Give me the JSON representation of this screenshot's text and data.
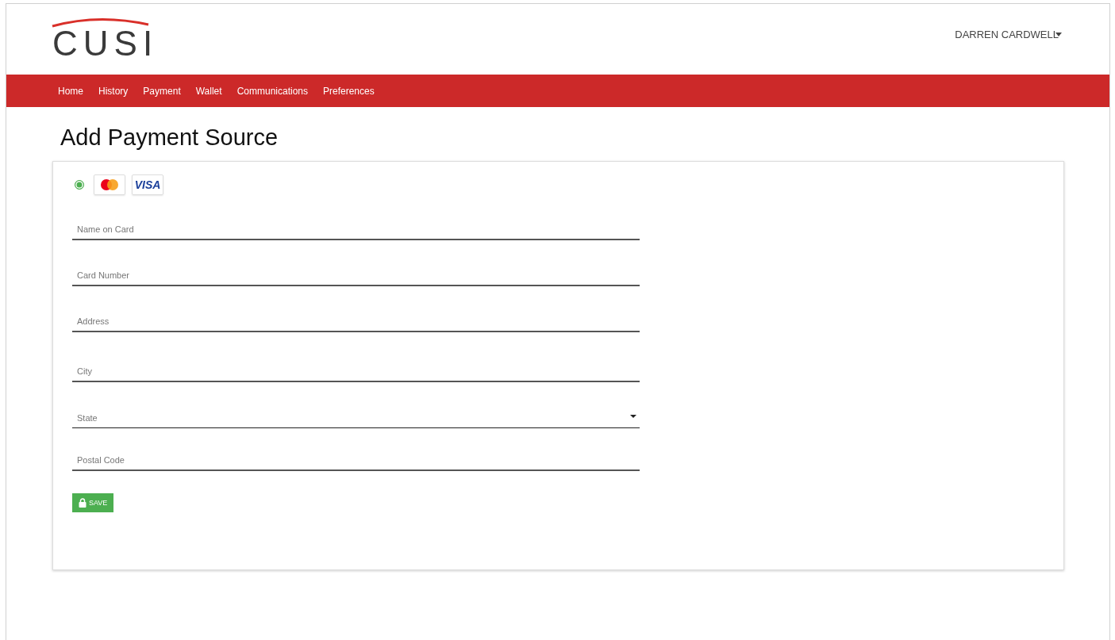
{
  "header": {
    "logo": "CUSI",
    "user": "DARREN CARDWELL"
  },
  "nav": [
    "Home",
    "History",
    "Payment",
    "Wallet",
    "Communications",
    "Preferences"
  ],
  "title": "Add Payment Source",
  "payment_option": {
    "selected": true,
    "brands": [
      {
        "kind": "mastercard"
      },
      {
        "kind": "visa",
        "label": "VISA"
      }
    ]
  },
  "fields": [
    {
      "kind": "text",
      "placeholder": "Name on Card"
    },
    {
      "kind": "text",
      "placeholder": "Card Number"
    },
    {
      "kind": "text",
      "placeholder": "Address"
    },
    {
      "kind": "text",
      "placeholder": "City"
    },
    {
      "kind": "select",
      "placeholder": "State"
    },
    {
      "kind": "text",
      "placeholder": "Postal Code"
    }
  ],
  "save_button": "SAVE"
}
